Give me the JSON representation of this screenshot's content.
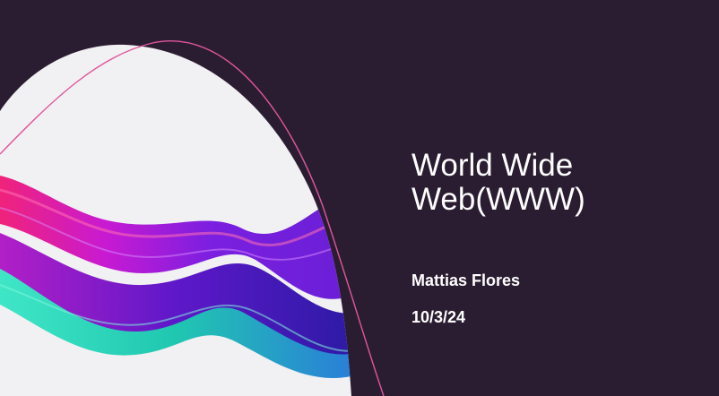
{
  "slide": {
    "title": "World Wide Web(WWW)",
    "author": "Mattias Flores",
    "date": "10/3/24"
  },
  "colors": {
    "background": "#2b1d31",
    "blob": "#f1f0f2",
    "accent_line": "#e0569e",
    "wave_pink": "#ec1f7c",
    "wave_purple": "#6a1fd6",
    "wave_teal": "#21d8a8"
  }
}
